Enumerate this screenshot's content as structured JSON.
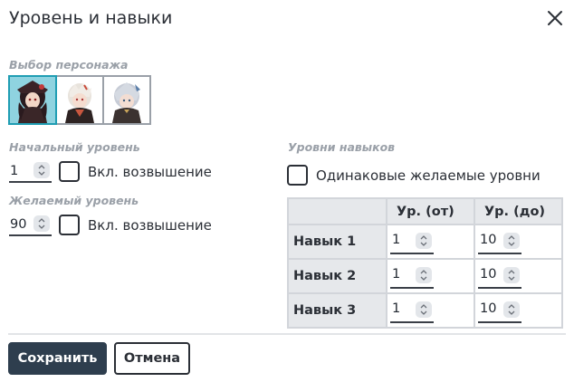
{
  "dialog": {
    "title": "Уровень и навыки",
    "close_icon": "close-icon"
  },
  "character": {
    "label": "Выбор персонажа",
    "items": [
      {
        "name": "character-1",
        "selected": true
      },
      {
        "name": "character-2",
        "selected": false
      },
      {
        "name": "character-3",
        "selected": false
      }
    ]
  },
  "level": {
    "start_label": "Начальный уровень",
    "start_value": "1",
    "start_ascension_label": "Вкл. возвышение",
    "desired_label": "Желаемый уровень",
    "desired_value": "90",
    "desired_ascension_label": "Вкл. возвышение"
  },
  "skills": {
    "label": "Уровни навыков",
    "same_levels_label": "Одинаковые желаемые уровни",
    "columns": [
      "",
      "Ур. (от)",
      "Ур. (до)"
    ],
    "rows": [
      {
        "name": "Навык 1",
        "from": "1",
        "to": "10"
      },
      {
        "name": "Навык 2",
        "from": "1",
        "to": "10"
      },
      {
        "name": "Навык 3",
        "from": "1",
        "to": "10"
      }
    ]
  },
  "actions": {
    "save_label": "Сохранить",
    "cancel_label": "Отмена"
  },
  "colors": {
    "primary_button": "#2e3e4e",
    "selected_character": "#8fd3e0",
    "label_gray": "#9aa0a8"
  }
}
